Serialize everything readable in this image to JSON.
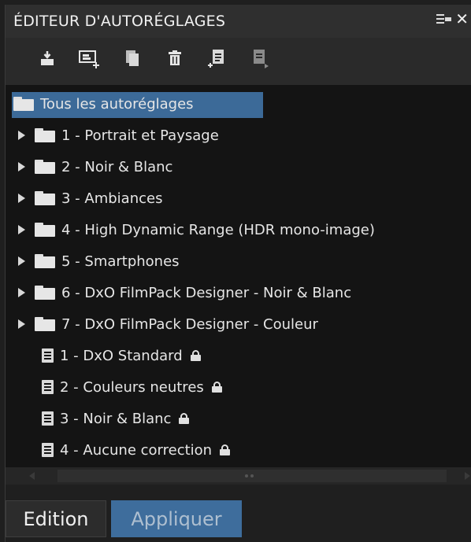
{
  "window": {
    "title": "ÉDITEUR D'AUTORÉGLAGES",
    "menu_icon": "panel-menu-icon",
    "close_icon": "close-icon"
  },
  "toolbar": {
    "buttons": [
      {
        "name": "import-preset",
        "icon": "import-icon"
      },
      {
        "name": "new-preset-from-image",
        "icon": "new-preset-icon"
      },
      {
        "name": "duplicate-preset",
        "icon": "duplicate-icon"
      },
      {
        "name": "delete-preset",
        "icon": "trash-icon"
      },
      {
        "name": "new-preset",
        "icon": "new-preset-doc-icon"
      },
      {
        "name": "new-partial-preset",
        "icon": "partial-preset-icon"
      }
    ]
  },
  "tree": {
    "root": {
      "label": "Tous les autoréglages",
      "selected": true
    },
    "folders": [
      {
        "label": "1 - Portrait et Paysage"
      },
      {
        "label": "2 - Noir & Blanc"
      },
      {
        "label": "3 - Ambiances"
      },
      {
        "label": "4 - High Dynamic Range (HDR mono-image)"
      },
      {
        "label": "5 - Smartphones"
      },
      {
        "label": "6 - DxO FilmPack Designer - Noir & Blanc"
      },
      {
        "label": "7 - DxO FilmPack Designer - Couleur"
      }
    ],
    "presets": [
      {
        "label": "1 - DxO Standard",
        "locked": true
      },
      {
        "label": "2 - Couleurs neutres",
        "locked": true
      },
      {
        "label": "3 - Noir & Blanc",
        "locked": true
      },
      {
        "label": "4 - Aucune correction",
        "locked": true
      }
    ]
  },
  "tabs": {
    "edition": "Edition",
    "appliquer": "Appliquer",
    "active": "appliquer"
  },
  "colors": {
    "selection": "#3c6a98",
    "active_tab": "#3e6d9c",
    "tree_bg": "#141414"
  }
}
